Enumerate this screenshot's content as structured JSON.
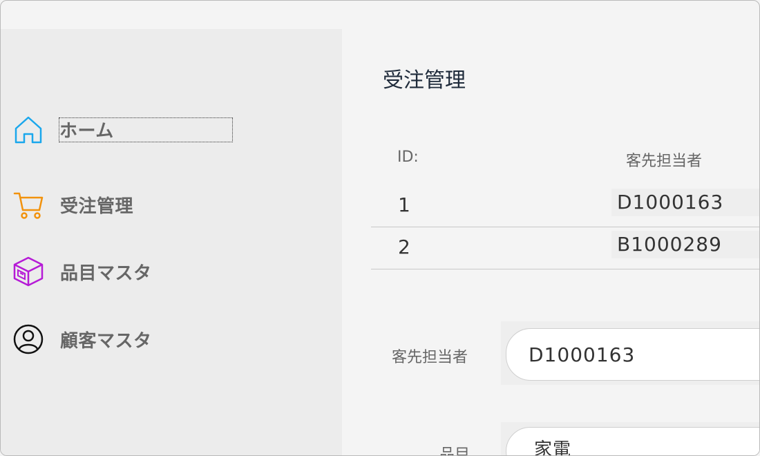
{
  "sidebar": {
    "items": [
      {
        "label": "ホーム",
        "icon": "home-icon",
        "color": "#1aa7ec"
      },
      {
        "label": "受注管理",
        "icon": "cart-icon",
        "color": "#f2920c"
      },
      {
        "label": "品目マスタ",
        "icon": "box-icon",
        "color": "#b51ad6"
      },
      {
        "label": "顧客マスタ",
        "icon": "person-icon",
        "color": "#111111"
      }
    ]
  },
  "main": {
    "title": "受注管理",
    "table": {
      "headers": [
        "ID:",
        "客先担当者"
      ],
      "rows": [
        {
          "id": "1",
          "customer": "D1000163"
        },
        {
          "id": "2",
          "customer": "B1000289"
        }
      ]
    },
    "form": {
      "customer_label": "客先担当者",
      "customer_value": "D1000163",
      "item_label": "品目",
      "item_value": "家電"
    }
  }
}
